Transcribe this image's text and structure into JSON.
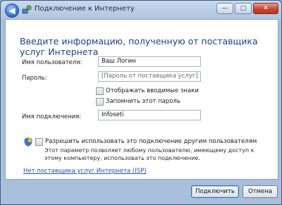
{
  "window": {
    "title": "Подключение к Интернету",
    "minimize_glyph": "—",
    "maximize_glyph": "□",
    "close_glyph": "✕",
    "back_glyph": "◀"
  },
  "main": {
    "heading": "Введите информацию, полученную от поставщика услуг Интернета",
    "username": {
      "label": "Имя пользователя:",
      "value": "Ваш Логин"
    },
    "password": {
      "label": "Пароль:",
      "placeholder": "[Пароль от поставщика услуг]"
    },
    "show_chars_label": "Отображать вводимые знаки",
    "remember_password_label": "Запомнить этот пароль",
    "connection_name": {
      "label": "Имя подключения:",
      "value": "Infoseti"
    },
    "allow_others_label": "Разрешить использовать это подключение другим пользователям",
    "allow_others_description": "Этот параметр позволяет любому пользователю, имеющему доступ к этому компьютеру, использовать это подключение.",
    "no_isp_link": "Нет поставщика услуг Интернета (ISP)"
  },
  "footer": {
    "connect_label": "Подключить",
    "cancel_label": "Отмена"
  }
}
